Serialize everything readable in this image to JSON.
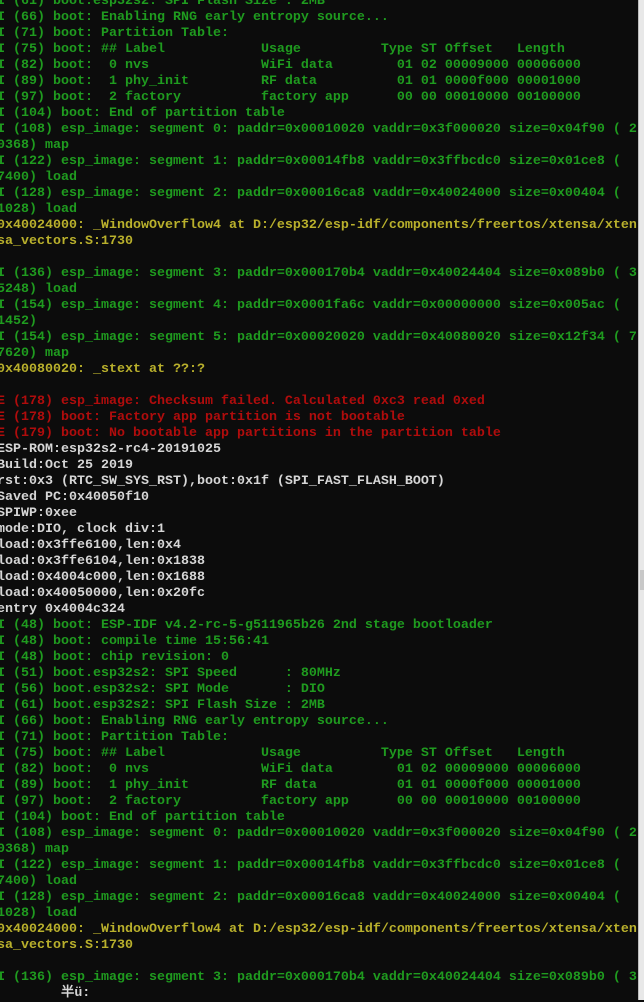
{
  "colors": {
    "info": "#1f9b1f",
    "addr": "#b9b02c",
    "error": "#b00c0c",
    "plain": "#d6d6d6",
    "background": "#0c0c0c"
  },
  "lines": [
    {
      "c": "g",
      "t": "I (61) boot.esp32s2: SPI Flash Size : 2MB"
    },
    {
      "c": "g",
      "t": "I (66) boot: Enabling RNG early entropy source..."
    },
    {
      "c": "g",
      "t": "I (71) boot: Partition Table:"
    },
    {
      "c": "g",
      "t": "I (75) boot: ## Label            Usage          Type ST Offset   Length"
    },
    {
      "c": "g",
      "t": "I (82) boot:  0 nvs              WiFi data        01 02 00009000 00006000"
    },
    {
      "c": "g",
      "t": "I (89) boot:  1 phy_init         RF data          01 01 0000f000 00001000"
    },
    {
      "c": "g",
      "t": "I (97) boot:  2 factory          factory app      00 00 00010000 00100000"
    },
    {
      "c": "g",
      "t": "I (104) boot: End of partition table"
    },
    {
      "c": "g",
      "t": "I (108) esp_image: segment 0: paddr=0x00010020 vaddr=0x3f000020 size=0x04f90 ( 2"
    },
    {
      "c": "g",
      "t": "0368) map"
    },
    {
      "c": "g",
      "t": "I (122) esp_image: segment 1: paddr=0x00014fb8 vaddr=0x3ffbcdc0 size=0x01ce8 ("
    },
    {
      "c": "g",
      "t": "7400) load"
    },
    {
      "c": "g",
      "t": "I (128) esp_image: segment 2: paddr=0x00016ca8 vaddr=0x40024000 size=0x00404 ("
    },
    {
      "c": "g",
      "t": "1028) load"
    },
    {
      "c": "y",
      "t": "0x40024000: _WindowOverflow4 at D:/esp32/esp-idf/components/freertos/xtensa/xten"
    },
    {
      "c": "y",
      "t": "sa_vectors.S:1730"
    },
    {
      "c": "w",
      "t": ""
    },
    {
      "c": "g",
      "t": "I (136) esp_image: segment 3: paddr=0x000170b4 vaddr=0x40024404 size=0x089b0 ( 3"
    },
    {
      "c": "g",
      "t": "5248) load"
    },
    {
      "c": "g",
      "t": "I (154) esp_image: segment 4: paddr=0x0001fa6c vaddr=0x00000000 size=0x005ac ("
    },
    {
      "c": "g",
      "t": "1452)"
    },
    {
      "c": "g",
      "t": "I (154) esp_image: segment 5: paddr=0x00020020 vaddr=0x40080020 size=0x12f34 ( 7"
    },
    {
      "c": "g",
      "t": "7620) map"
    },
    {
      "c": "y",
      "t": "0x40080020: _stext at ??:?"
    },
    {
      "c": "w",
      "t": ""
    },
    {
      "c": "r",
      "t": "E (178) esp_image: Checksum failed. Calculated 0xc3 read 0xed"
    },
    {
      "c": "r",
      "t": "E (178) boot: Factory app partition is not bootable"
    },
    {
      "c": "r",
      "t": "E (179) boot: No bootable app partitions in the partition table"
    },
    {
      "c": "w",
      "t": "ESP-ROM:esp32s2-rc4-20191025"
    },
    {
      "c": "w",
      "t": "Build:Oct 25 2019"
    },
    {
      "c": "w",
      "t": "rst:0x3 (RTC_SW_SYS_RST),boot:0x1f (SPI_FAST_FLASH_BOOT)"
    },
    {
      "c": "w",
      "t": "Saved PC:0x40050f10"
    },
    {
      "c": "w",
      "t": "SPIWP:0xee"
    },
    {
      "c": "w",
      "t": "mode:DIO, clock div:1"
    },
    {
      "c": "w",
      "t": "load:0x3ffe6100,len:0x4"
    },
    {
      "c": "w",
      "t": "load:0x3ffe6104,len:0x1838"
    },
    {
      "c": "w",
      "t": "load:0x4004c000,len:0x1688"
    },
    {
      "c": "w",
      "t": "load:0x40050000,len:0x20fc"
    },
    {
      "c": "w",
      "t": "entry 0x4004c324"
    },
    {
      "c": "g",
      "t": "I (48) boot: ESP-IDF v4.2-rc-5-g511965b26 2nd stage bootloader"
    },
    {
      "c": "g",
      "t": "I (48) boot: compile time 15:56:41"
    },
    {
      "c": "g",
      "t": "I (48) boot: chip revision: 0"
    },
    {
      "c": "g",
      "t": "I (51) boot.esp32s2: SPI Speed      : 80MHz"
    },
    {
      "c": "g",
      "t": "I (56) boot.esp32s2: SPI Mode       : DIO"
    },
    {
      "c": "g",
      "t": "I (61) boot.esp32s2: SPI Flash Size : 2MB"
    },
    {
      "c": "g",
      "t": "I (66) boot: Enabling RNG early entropy source..."
    },
    {
      "c": "g",
      "t": "I (71) boot: Partition Table:"
    },
    {
      "c": "g",
      "t": "I (75) boot: ## Label            Usage          Type ST Offset   Length"
    },
    {
      "c": "g",
      "t": "I (82) boot:  0 nvs              WiFi data        01 02 00009000 00006000"
    },
    {
      "c": "g",
      "t": "I (89) boot:  1 phy_init         RF data          01 01 0000f000 00001000"
    },
    {
      "c": "g",
      "t": "I (97) boot:  2 factory          factory app      00 00 00010000 00100000"
    },
    {
      "c": "g",
      "t": "I (104) boot: End of partition table"
    },
    {
      "c": "g",
      "t": "I (108) esp_image: segment 0: paddr=0x00010020 vaddr=0x3f000020 size=0x04f90 ( 2"
    },
    {
      "c": "g",
      "t": "0368) map"
    },
    {
      "c": "g",
      "t": "I (122) esp_image: segment 1: paddr=0x00014fb8 vaddr=0x3ffbcdc0 size=0x01ce8 ("
    },
    {
      "c": "g",
      "t": "7400) load"
    },
    {
      "c": "g",
      "t": "I (128) esp_image: segment 2: paddr=0x00016ca8 vaddr=0x40024000 size=0x00404 ("
    },
    {
      "c": "g",
      "t": "1028) load"
    },
    {
      "c": "y",
      "t": "0x40024000: _WindowOverflow4 at D:/esp32/esp-idf/components/freertos/xtensa/xten"
    },
    {
      "c": "y",
      "t": "sa_vectors.S:1730"
    },
    {
      "c": "w",
      "t": ""
    },
    {
      "c": "g",
      "t": "I (136) esp_image: segment 3: paddr=0x000170b4 vaddr=0x40024404 size=0x089b0 ( 3"
    }
  ],
  "ime_status": "        半ü:"
}
